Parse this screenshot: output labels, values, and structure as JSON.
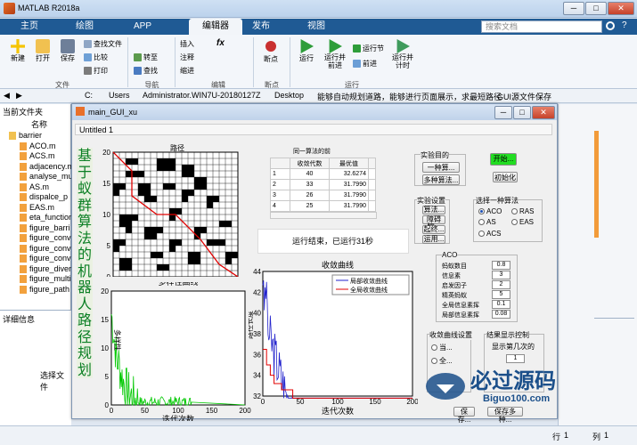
{
  "app": {
    "title": "MATLAB R2018a",
    "min": "─",
    "max": "□",
    "close": "✕"
  },
  "tabs": [
    "主页",
    "绘图",
    "APP",
    "编辑器",
    "发布",
    "视图"
  ],
  "search_placeholder": "搜索文档",
  "ribbon": {
    "new": "新建",
    "open": "打开",
    "save": "保存",
    "find_files": "查找文件",
    "compare": "比较",
    "print": "打印",
    "goto": "转至",
    "find": "查找",
    "insert": "插入",
    "fx": "fx",
    "comment": "注释",
    "indent": "缩进",
    "breakpoints": "断点",
    "run": "运行",
    "run_advance": "运行并\n前进",
    "run_section": "运行节",
    "advance": "前进",
    "run_time": "运行并\n计时",
    "groups": [
      "文件",
      "导航",
      "编辑",
      "断点",
      "运行"
    ]
  },
  "address": {
    "parts": [
      "C:",
      "Users",
      "Administrator.WIN7U-20180127Z",
      "Desktop",
      "能够自动规划道路，能够进行页面展示，求最短路径",
      "GUI源文件保存"
    ]
  },
  "left_panel": {
    "header": "当前文件夹",
    "col_name": "名称",
    "files": [
      "barrier",
      "ACO.m",
      "ACS.m",
      "adjacency.m",
      "analyse_mu",
      "AS.m",
      "dispalce_p",
      "EAS.m",
      "eta_function",
      "figure_barri",
      "figure_conv",
      "figure_conv",
      "figure_conv",
      "figure_diver",
      "figure_multi",
      "figure_path"
    ],
    "detail_header": "详细信息",
    "detail_text": "选择文件"
  },
  "status": {
    "row": "行",
    "row_val": "1",
    "col": "列",
    "col_val": "1"
  },
  "gui": {
    "title": "main_GUI_xu",
    "menu": "Untitled 1",
    "vertical_title": "基于蚁群算法的机器人路径规划",
    "path_plot": {
      "title": "路径",
      "ticks_x": [
        "0",
        "5",
        "10",
        "15",
        "20"
      ],
      "ticks_y": [
        "20",
        "15",
        "10",
        "5",
        "0"
      ]
    },
    "diversity_plot": {
      "title": "多样性曲线",
      "xlabel": "迭代次数",
      "ylabel": "多样性",
      "ticks_x": [
        "0",
        "50",
        "100",
        "150",
        "200"
      ],
      "ticks_y": [
        "20",
        "15",
        "10",
        "5",
        "0"
      ]
    },
    "conv_plot": {
      "title": "收敛曲线",
      "xlabel": "迭代次数",
      "ylabel": "路径长度",
      "legend": [
        "局部收敛曲线",
        "全局收敛曲线"
      ],
      "ticks_x": [
        "0",
        "50",
        "100",
        "150",
        "200"
      ],
      "ticks_y": [
        "44",
        "42",
        "40",
        "38",
        "36",
        "34",
        "32"
      ]
    },
    "table": {
      "caption": "同一算法的前",
      "headers": [
        "收敛代数",
        "最优值"
      ],
      "rows": [
        [
          "1",
          "40",
          "32.6274"
        ],
        [
          "2",
          "33",
          "31.7990"
        ],
        [
          "3",
          "26",
          "31.7990"
        ],
        [
          "4",
          "25",
          "31.7990"
        ]
      ]
    },
    "run_status": "运行结束，已运行31秒",
    "exp_purpose": {
      "title": "实验目的",
      "btn1": "一种算...",
      "btn2": "多种算法..."
    },
    "exp_settings": {
      "title": "实验设置",
      "b1": "算法...",
      "b2": "障碍物...",
      "b3": "起终...",
      "b4": "运用..."
    },
    "start": "开始...",
    "init": "初始化",
    "algo_choice": {
      "title": "选择一种算法",
      "opts": [
        "ACO",
        "RAS",
        "AS",
        "EAS",
        "ACS"
      ]
    },
    "aco": {
      "title": "ACO",
      "params": [
        [
          "蚂蚁数目",
          "0.8"
        ],
        [
          "信息素",
          "3"
        ],
        [
          "启发因子",
          "2"
        ],
        [
          "精英蚂蚁",
          "5"
        ],
        [
          "全局信息素挥",
          "0.1"
        ],
        [
          "局部信息素挥",
          "0.08"
        ]
      ]
    },
    "conv_setting": {
      "title": "收敛曲线设置",
      "opt1": "当...",
      "opt2": "全..."
    },
    "result_ctrl": {
      "title": "结果显示控制",
      "sub": "显示第几次的",
      "val": "1"
    },
    "save1": "保存...",
    "save2": "保存多种..."
  },
  "watermark": {
    "line1": "必过源码",
    "line2": "Biguo100.com"
  },
  "colors": {
    "blue_tab": "#1f5a94",
    "green_title": "#0b7f24",
    "path_red": "#e00000",
    "conv_blue": "#2222cc",
    "div_green": "#00c800"
  }
}
